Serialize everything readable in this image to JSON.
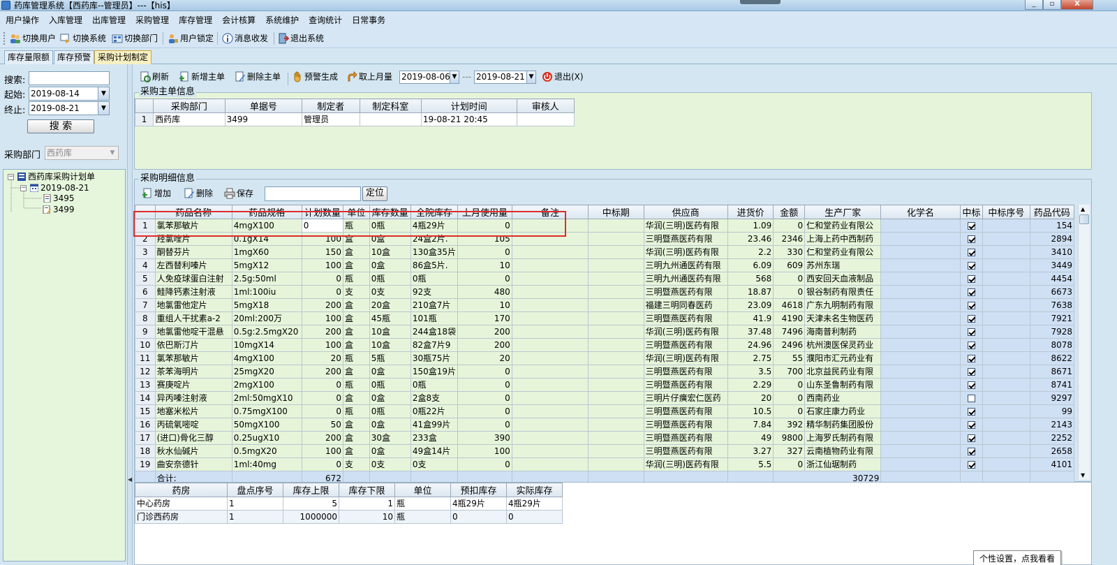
{
  "window": {
    "title": "药库管理系统【西药库--管理员】---【his】",
    "controls": {
      "minimize": "_",
      "restore": "▫",
      "close": "X"
    }
  },
  "menu": [
    "用户操作",
    "入库管理",
    "出库管理",
    "采购管理",
    "库存管理",
    "会计核算",
    "系统维护",
    "查询统计",
    "日常事务"
  ],
  "toolbar": {
    "switch_user": "切换用户",
    "switch_system": "切换系统",
    "switch_dept": "切换部门",
    "lock_user": "用户锁定",
    "messages": "消息收发",
    "exit": "退出系统"
  },
  "tabs": [
    "库存量限额",
    "库存预警",
    "采购计划制定"
  ],
  "left": {
    "search_label": "搜索:",
    "search_value": "",
    "start_label": "起始:",
    "start_value": "2019-08-14",
    "end_label": "终止:",
    "end_value": "2019-08-21",
    "search_button": "搜  索",
    "dept_label": "采购部门",
    "dept_value": "西药库",
    "tree": {
      "root": "西药库采购计划单",
      "date": "2019-08-21",
      "items": [
        "3495",
        "3499"
      ]
    }
  },
  "actions": {
    "refresh": "刷新",
    "add_master": "新增主单",
    "delete_master": "删除主单",
    "warning_gen": "预警生成",
    "last_month": "取上月量",
    "date_from": "2019-08-06",
    "date_dash": "---",
    "date_to": "2019-08-21",
    "exit": "退出(X)"
  },
  "master": {
    "title": "采购主单信息",
    "columns": [
      "采购部门",
      "单据号",
      "制定者",
      "制定科室",
      "计划时间",
      "审核人"
    ],
    "rows": [
      [
        "1",
        "西药库",
        "3499",
        "管理员",
        "",
        "19-08-21 20:45",
        ""
      ]
    ]
  },
  "detail": {
    "title": "采购明细信息",
    "add": "增加",
    "delete": "删除",
    "save": "保存",
    "locate": "定位",
    "locate_value": "",
    "columns": [
      "药品名称",
      "药品规格",
      "计划数量",
      "单位",
      "库存数量",
      "全院库存",
      "上月使用量",
      "备注",
      "中标期",
      "供应商",
      "进货价",
      "金额",
      "生产厂家",
      "化学名",
      "中标",
      "中标序号",
      "药品代码"
    ],
    "rows": [
      [
        "1",
        "氯苯那敏片",
        "4mgX100",
        "0",
        "瓶",
        "0瓶",
        "4瓶29片",
        "0",
        "",
        "",
        "华润(三明)医药有限",
        "1.09",
        "0",
        "仁和堂药业有限公",
        "",
        true,
        "",
        "154"
      ],
      [
        "2",
        "羟氯喹片",
        "0.1gX14",
        "100",
        "盒",
        "0盒",
        "24盒2片.",
        "105",
        "",
        "",
        "三明暨燕医药有限",
        "23.46",
        "2346",
        "上海上药中西制药",
        "",
        true,
        "",
        "2894"
      ],
      [
        "3",
        "酮替芬片",
        "1mgX60",
        "150",
        "盒",
        "10盒",
        "130盒35片",
        "0",
        "",
        "",
        "华润(三明)医药有限",
        "2.2",
        "330",
        "仁和堂药业有限公",
        "",
        true,
        "",
        "3410"
      ],
      [
        "4",
        "左西替利嗪片",
        "5mgX12",
        "100",
        "盒",
        "0盒",
        "86盒5片.",
        "10",
        "",
        "",
        "三明九州通医药有限",
        "6.09",
        "609",
        "苏州东瑞",
        "",
        true,
        "",
        "3449"
      ],
      [
        "5",
        "人免疫球蛋白注射",
        "2.5g:50ml",
        "0",
        "瓶",
        "0瓶",
        "0瓶",
        "0",
        "",
        "",
        "三明九州通医药有限",
        "568",
        "0",
        "西安回天血液制品",
        "",
        true,
        "",
        "4454"
      ],
      [
        "6",
        "鲑降钙素注射液",
        "1ml:100iu",
        "0",
        "支",
        "0支",
        "92支",
        "480",
        "",
        "",
        "三明暨燕医药有限",
        "18.87",
        "0",
        "银谷制药有限责任",
        "",
        true,
        "",
        "6673"
      ],
      [
        "7",
        "地氯雷他定片",
        "5mgX18",
        "200",
        "盒",
        "20盒",
        "210盒7片",
        "10",
        "",
        "",
        "福建三明同春医药",
        "23.09",
        "4618",
        "广东九明制药有限",
        "",
        true,
        "",
        "7638"
      ],
      [
        "8",
        "重组人干扰素a-2",
        "20ml:200万",
        "100",
        "盒",
        "45瓶",
        "101瓶",
        "170",
        "",
        "",
        "三明暨燕医药有限",
        "41.9",
        "4190",
        "天津未名生物医药",
        "",
        true,
        "",
        "7921"
      ],
      [
        "9",
        "地氯雷他啶干混悬",
        "0.5g:2.5mgX20",
        "200",
        "盒",
        "10盒",
        "244盒18袋",
        "200",
        "",
        "",
        "华润(三明)医药有限",
        "37.48",
        "7496",
        "海南普利制药",
        "",
        true,
        "",
        "7928"
      ],
      [
        "10",
        "依巴斯汀片",
        "10mgX14",
        "100",
        "盒",
        "10盒",
        "82盒7片9",
        "200",
        "",
        "",
        "三明暨燕医药有限",
        "24.96",
        "2496",
        "杭州澳医保灵药业",
        "",
        true,
        "",
        "8078"
      ],
      [
        "11",
        "氯苯那敏片",
        "4mgX100",
        "20",
        "瓶",
        "5瓶",
        "30瓶75片",
        "20",
        "",
        "",
        "华润(三明)医药有限",
        "2.75",
        "55",
        "濮阳市汇元药业有",
        "",
        true,
        "",
        "8622"
      ],
      [
        "12",
        "茶苯海明片",
        "25mgX20",
        "200",
        "盒",
        "0盒",
        "150盒19片",
        "0",
        "",
        "",
        "三明暨燕医药有限",
        "3.5",
        "700",
        "北京益民药业有限",
        "",
        true,
        "",
        "8671"
      ],
      [
        "13",
        "赛庚啶片",
        "2mgX100",
        "0",
        "瓶",
        "0瓶",
        "0瓶",
        "0",
        "",
        "",
        "三明暨燕医药有限",
        "2.29",
        "0",
        "山东圣鲁制药有限",
        "",
        true,
        "",
        "8741"
      ],
      [
        "14",
        "异丙嗪注射液",
        "2ml:50mgX10",
        "0",
        "盒",
        "0盒",
        "2盒8支",
        "0",
        "",
        "",
        "三明片仔癀宏仁医药",
        "20",
        "0",
        "西南药业",
        "",
        false,
        "",
        "9297"
      ],
      [
        "15",
        "地塞米松片",
        "0.75mgX100",
        "0",
        "瓶",
        "0瓶",
        "0瓶22片",
        "0",
        "",
        "",
        "三明暨燕医药有限",
        "10.5",
        "0",
        "石家庄康力药业",
        "",
        true,
        "",
        "99"
      ],
      [
        "16",
        "丙硫氧嘧啶",
        "50mgX100",
        "50",
        "盒",
        "0盒",
        "41盒99片",
        "0",
        "",
        "",
        "三明暨燕医药有限",
        "7.84",
        "392",
        "精华制药集团股份",
        "",
        true,
        "",
        "2143"
      ],
      [
        "17",
        "(进口)骨化三醇",
        "0.25ugX10",
        "200",
        "盒",
        "30盒",
        "233盒",
        "390",
        "",
        "",
        "三明暨燕医药有限",
        "49",
        "9800",
        "上海罗氏制药有限",
        "",
        true,
        "",
        "2252"
      ],
      [
        "18",
        "秋水仙碱片",
        "0.5mgX20",
        "100",
        "盒",
        "0盒",
        "49盒14片",
        "100",
        "",
        "",
        "三明暨燕医药有限",
        "3.27",
        "327",
        "云南植物药业有限",
        "",
        true,
        "",
        "2658"
      ],
      [
        "19",
        "曲安奈德针",
        "1ml:40mg",
        "0",
        "支",
        "0支",
        "0支",
        "0",
        "",
        "",
        "华润(三明)医药有限",
        "5.5",
        "0",
        "浙江仙琚制药",
        "",
        true,
        "",
        "4101"
      ]
    ],
    "total_label": "合计:",
    "total_qty": "672",
    "total_amount": "30729"
  },
  "stock": {
    "columns": [
      "药房",
      "盘点序号",
      "库存上限",
      "库存下限",
      "单位",
      "预扣库存",
      "实际库存"
    ],
    "rows": [
      [
        "中心药房",
        "1",
        "5",
        "1",
        "瓶",
        "4瓶29片",
        "4瓶29片"
      ],
      [
        "门诊西药房",
        "1",
        "1000000",
        "10",
        "瓶",
        "0",
        "0"
      ]
    ]
  },
  "tooltip": "个性设置，点我看看",
  "colors": {
    "grid_green": "#e6f5d9",
    "header_blue": "#d6e6f4",
    "highlight_red": "#e02a2a",
    "active_tab": "#f7f0c2"
  }
}
